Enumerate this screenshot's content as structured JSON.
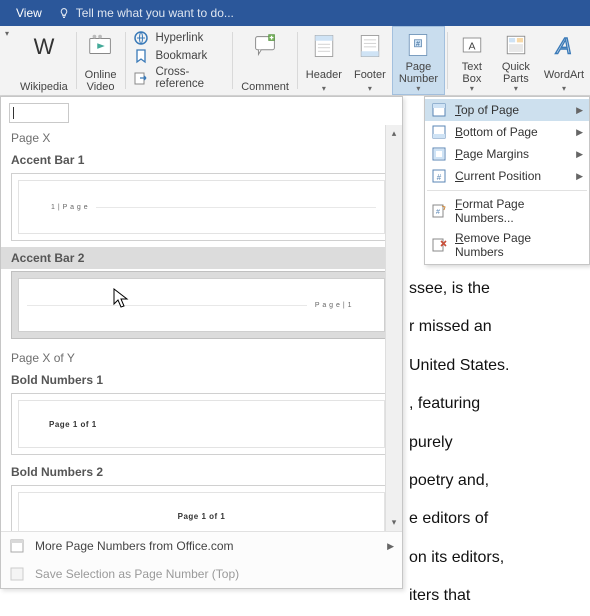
{
  "titlebar": {
    "view": "View",
    "tell": "Tell me what you want to do..."
  },
  "ribbon": {
    "wikipedia": "Wikipedia",
    "video": "Online\nVideo",
    "hyperlink": "Hyperlink",
    "bookmark": "Bookmark",
    "crossref": "Cross-reference",
    "comment": "Comment",
    "header": "Header",
    "footer": "Footer",
    "pagenum": "Page\nNumber",
    "textbox": "Text\nBox",
    "quickparts": "Quick\nParts",
    "wordart": "WordArt"
  },
  "menu": {
    "top": "op of Page",
    "top_u": "T",
    "bottom": "ottom of Page",
    "bottom_u": "B",
    "margins": "age Margins",
    "margins_u": "P",
    "current": "urrent Position",
    "current_u": "C",
    "format": "ormat Page Numbers...",
    "format_u": "F",
    "remove": "emove Page Numbers",
    "remove_u": "R"
  },
  "gallery": {
    "sec_pagex": "Page X",
    "accent1": "Accent Bar 1",
    "accent1_sample": "1 | P a g e",
    "accent2": "Accent Bar 2",
    "accent2_sample": "P a g e | 1",
    "sec_pagexofy": "Page X of Y",
    "bold1": "Bold Numbers 1",
    "bold1_sample": "Page 1 of 1",
    "bold2": "Bold Numbers 2",
    "bold2_sample": "Page 1 of 1",
    "more": "ore Page Numbers from Office.com",
    "more_u": "M",
    "save": "ave Selection as Page Number (Top)",
    "save_u": "S"
  },
  "doc_lines": [
    "ssee, is the",
    "r missed an",
    "United States.",
    ", featuring",
    "purely",
    "poetry and,",
    "e editors of",
    "on its editors,",
    "iters that"
  ]
}
